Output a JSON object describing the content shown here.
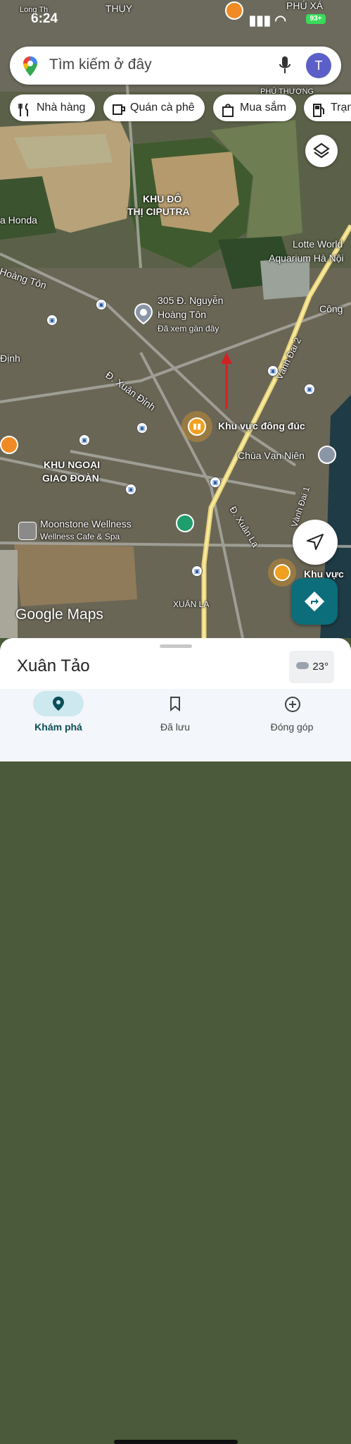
{
  "status_bar": {
    "time": "6:24",
    "battery": "93+"
  },
  "search": {
    "placeholder": "Tìm kiếm ở đây",
    "avatar_letter": "T"
  },
  "chips": [
    {
      "label": "Nhà hàng",
      "icon": "fork-knife-icon"
    },
    {
      "label": "Quán cà phê",
      "icon": "coffee-icon"
    },
    {
      "label": "Mua sắm",
      "icon": "shopping-bag-icon"
    },
    {
      "label": "Trạm",
      "icon": "gas-station-icon"
    }
  ],
  "map_labels": {
    "khu_do_thi_1": "KHU ĐÔ",
    "khu_do_thi_2": "THỊ CIPUTRA",
    "honda": "a Honda",
    "hoang_ton": "Hoàng Tôn",
    "lotte_1": "Lotte World",
    "lotte_2": "Aquarium Hà Nội",
    "cong": "Công",
    "addr_1": "305 Đ. Nguyễn",
    "addr_2": "Hoàng Tôn",
    "addr_note": "Đã xem gần đây",
    "dinh": "Định",
    "xuan_dinh": "Đ. Xuân Đỉnh",
    "vanh_dai_2": "Vành Đai 2",
    "crowded": "Khu vực đông đúc",
    "chua": "Chùa Vạn Niên",
    "ngoai_giao_1": "KHU NGOẠI",
    "ngoai_giao_2": "GIAO ĐOÀN",
    "moonstone": "Moonstone Wellness",
    "moonstone_sub": "Wellness Cafe & Spa",
    "xuan_la_road": "Đ. Xuân La",
    "vanh_dai_1": "Vành Đai 1",
    "khu_vuc": "Khu vực",
    "xuan_la": "XUÂN LA",
    "thuy": "THỤY",
    "phu_xa": "PHÚ XÁ",
    "phu_thuong": "PHÚ THƯỢNG",
    "long_tho": "Long Th"
  },
  "google_logo": "Google Maps",
  "sheet": {
    "place": "Xuân Tảo",
    "temperature": "23°"
  },
  "tabs": [
    {
      "label": "Khám phá",
      "icon": "location-pin-icon",
      "active": true
    },
    {
      "label": "Đã lưu",
      "icon": "bookmark-icon",
      "active": false
    },
    {
      "label": "Đóng góp",
      "icon": "add-circle-icon",
      "active": false
    }
  ],
  "colors": {
    "accent": "#0b6e7a",
    "tab_active_bg": "#cde8ee",
    "crowd_icon": "#f0a020"
  }
}
